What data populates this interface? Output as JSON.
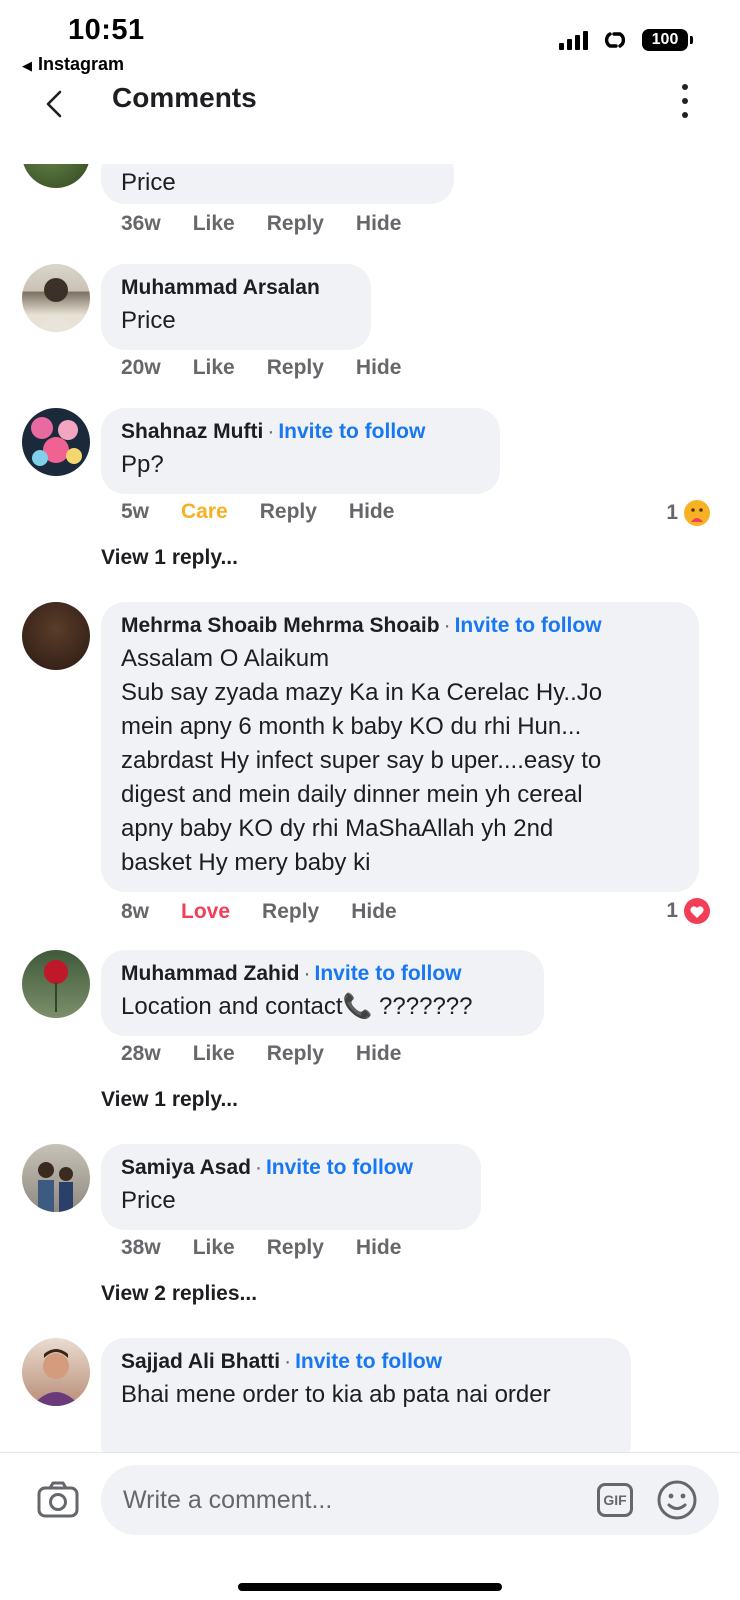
{
  "status": {
    "time": "10:51",
    "back_app": "Instagram",
    "battery": "100"
  },
  "header": {
    "title": "Comments"
  },
  "comments": [
    {
      "author": "",
      "text": "Price",
      "age": "36w",
      "reaction": "Like",
      "reply": "Reply",
      "hide": "Hide"
    },
    {
      "author": "Muhammad Arsalan",
      "text": "Price",
      "age": "20w",
      "reaction": "Like",
      "reply": "Reply",
      "hide": "Hide"
    },
    {
      "author": "Shahnaz Mufti",
      "follow": "Invite to follow",
      "text": "Pp?",
      "age": "5w",
      "reaction": "Care",
      "reply": "Reply",
      "hide": "Hide",
      "react_count": "1",
      "view_replies": "View 1 reply..."
    },
    {
      "author": "Mehrma Shoaib Mehrma Shoaib",
      "follow": "Invite to follow",
      "text_lines": [
        "Assalam O Alaikum",
        "Sub say zyada mazy Ka in Ka Cerelac Hy..Jo",
        "mein apny 6 month k baby KO du rhi Hun...",
        "zabrdast Hy infect super say b uper....easy to",
        "digest and mein daily dinner mein yh cereal",
        "apny baby KO dy rhi MaShaAllah yh 2nd",
        "basket Hy mery baby ki"
      ],
      "age": "8w",
      "reaction": "Love",
      "reply": "Reply",
      "hide": "Hide",
      "react_count": "1"
    },
    {
      "author": "Muhammad Zahid",
      "follow": "Invite to follow",
      "text": "Location and contact📞 ???????",
      "age": "28w",
      "reaction": "Like",
      "reply": "Reply",
      "hide": "Hide",
      "view_replies": "View 1 reply..."
    },
    {
      "author": "Samiya Asad",
      "follow": "Invite to follow",
      "text": "Price",
      "age": "38w",
      "reaction": "Like",
      "reply": "Reply",
      "hide": "Hide",
      "view_replies": "View 2 replies..."
    },
    {
      "author": "Sajjad Ali Bhatti",
      "follow": "Invite to follow",
      "text": "Bhai mene order to kia ab pata nai order"
    }
  ],
  "composer": {
    "placeholder": "Write a comment...",
    "gif": "GIF"
  },
  "colors": {
    "accent": "#1877f2",
    "care": "#f7b125",
    "love": "#f33e58",
    "bubble": "#f0f2f5"
  }
}
